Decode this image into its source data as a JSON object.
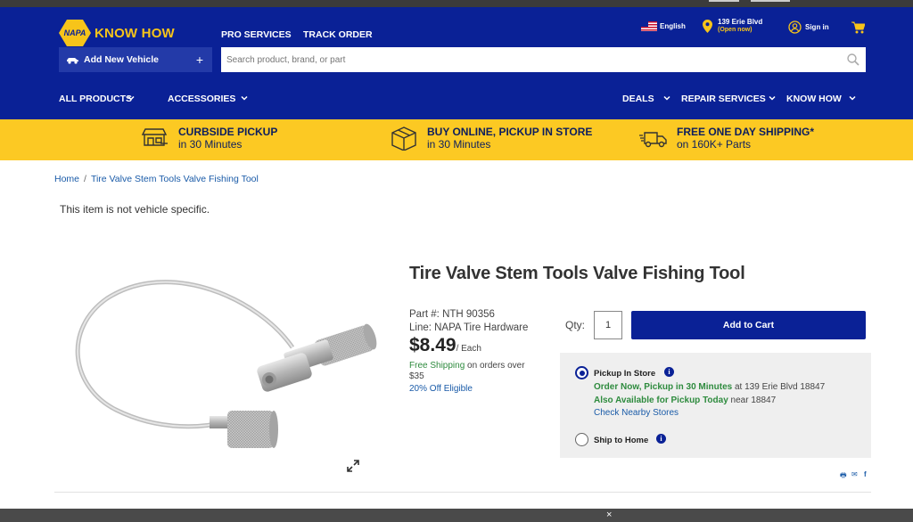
{
  "brand": {
    "logo_mark": "NAPA",
    "logo_text": "KNOW HOW",
    "color_primary": "#0a2196",
    "color_accent": "#fcc923"
  },
  "header": {
    "nav_top": [
      "PRO SERVICES",
      "TRACK ORDER"
    ],
    "language": "English",
    "store_name": "139 Erie Blvd",
    "store_status": "(Open now)",
    "sign_in": "Sign in",
    "add_vehicle": "Add New Vehicle",
    "add_vehicle_plus": "+",
    "search_placeholder": "Search product, brand, or part",
    "nav_main": [
      "ALL PRODUCTS",
      "ACCESSORIES",
      "DEALS",
      "REPAIR SERVICES",
      "KNOW HOW"
    ]
  },
  "promos": [
    {
      "title": "CURBSIDE PICKUP",
      "sub": "in 30 Minutes",
      "icon": "store-icon"
    },
    {
      "title": "BUY ONLINE, PICKUP IN STORE",
      "sub": "in 30 Minutes",
      "icon": "box-icon"
    },
    {
      "title": "FREE ONE DAY SHIPPING*",
      "sub": "on 160K+ Parts",
      "icon": "truck-icon"
    }
  ],
  "breadcrumb": {
    "home": "Home",
    "separator": "/",
    "current": "Tire Valve Stem Tools Valve Fishing Tool"
  },
  "vehicle_note": "This item is not vehicle specific.",
  "product": {
    "title": "Tire Valve Stem Tools Valve Fishing Tool",
    "part": "Part #: NTH 90356",
    "line": "Line: NAPA Tire Hardware",
    "price": "$8.49",
    "price_unit": "/ Each",
    "free_shipping": "Free Shipping",
    "shipping_rest": " on orders over $35",
    "discount": "20% Off Eligible"
  },
  "purchase": {
    "qty_label": "Qty:",
    "qty_value": "1",
    "add_to_cart": "Add to Cart",
    "pickup_label": "Pickup In Store",
    "pickup_line1_green": "Order Now, Pickup in 30 Minutes",
    "pickup_line1_rest": " at 139 Erie Blvd 18847",
    "pickup_line2_green": "Also Available for Pickup Today",
    "pickup_line2_rest": " near 18847",
    "nearby": "Check Nearby Stores",
    "ship_label": "Ship to Home",
    "info_glyph": "i"
  },
  "share": {
    "print": "🖶",
    "email": "✉",
    "facebook": "f"
  },
  "cookie_close": "×"
}
